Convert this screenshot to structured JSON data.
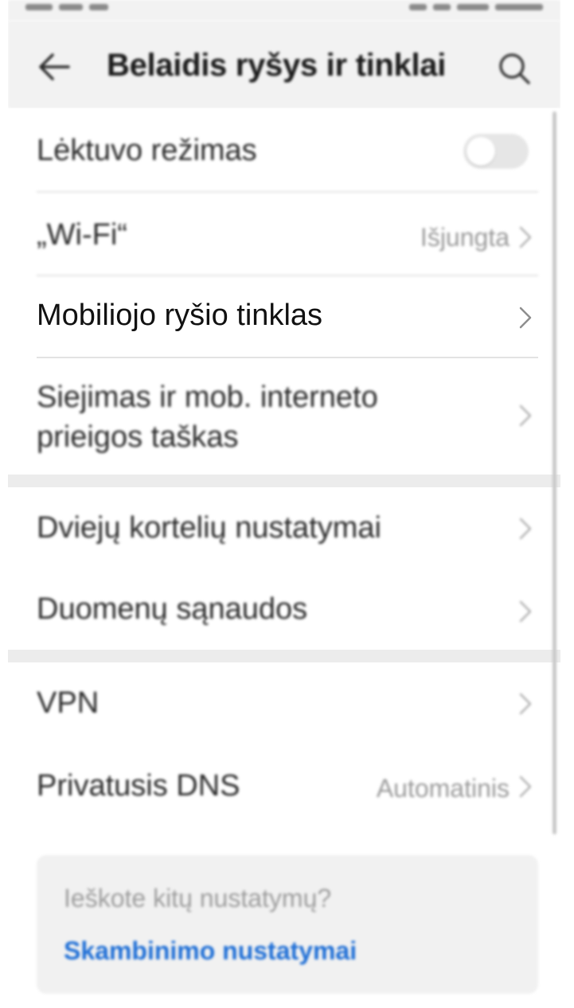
{
  "app_bar": {
    "title": "Belaidis ryšys ir tinklai",
    "back_icon": "arrow-left-icon",
    "search_icon": "search-icon"
  },
  "rows": {
    "airplane": {
      "label": "Lėktuvo režimas",
      "toggle_on": false
    },
    "wifi": {
      "label": "„Wi-Fi“",
      "value": "Išjungta"
    },
    "mobile": {
      "label": "Mobiliojo ryšio tinklas"
    },
    "tethering": {
      "label": "Siejimas ir mob. interneto prieigos taškas"
    },
    "dual_sim": {
      "label": "Dviejų kortelių nustatymai"
    },
    "data_usage": {
      "label": "Duomenų sąnaudos"
    },
    "vpn": {
      "label": "VPN"
    },
    "private_dns": {
      "label": "Privatusis DNS",
      "value": "Automatinis"
    }
  },
  "suggest": {
    "question": "Ieškote kitų nustatymų?",
    "link": "Skambinimo nustatymai"
  },
  "colors": {
    "link": "#1f6fd6",
    "app_bar_bg": "#f2f2f2",
    "section_gap": "#ececec"
  }
}
